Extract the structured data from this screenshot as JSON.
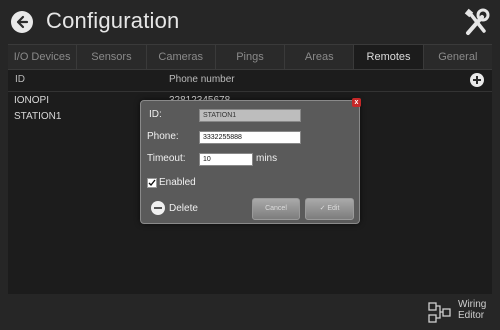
{
  "header": {
    "title": "Configuration",
    "back_icon": "back-arrow-icon",
    "tools_icon": "tools-icon"
  },
  "tabs": [
    {
      "label": "I/O Devices",
      "active": false
    },
    {
      "label": "Sensors",
      "active": false
    },
    {
      "label": "Cameras",
      "active": false
    },
    {
      "label": "Pings",
      "active": false
    },
    {
      "label": "Areas",
      "active": false
    },
    {
      "label": "Remotes",
      "active": true
    },
    {
      "label": "General",
      "active": false
    }
  ],
  "table": {
    "columns": {
      "id": "ID",
      "phone": "Phone number"
    },
    "rows": [
      {
        "id": "IONOPI",
        "phone": "32812345678"
      },
      {
        "id": "STATION1",
        "phone": ""
      }
    ]
  },
  "dialog": {
    "id_label": "ID:",
    "id_value": "STATION1",
    "phone_label": "Phone:",
    "phone_value": "3332255888",
    "timeout_label": "Timeout:",
    "timeout_value": "10",
    "timeout_unit": "mins",
    "enabled_label": "Enabled",
    "enabled": true,
    "delete_label": "Delete",
    "cancel_label": "Cancel",
    "edit_label": "Edit",
    "close_glyph": "x"
  },
  "footer": {
    "wiring_line1": "Wiring",
    "wiring_line2": "Editor"
  },
  "colors": {
    "accent_close": "#c62828",
    "background": "#262626"
  }
}
